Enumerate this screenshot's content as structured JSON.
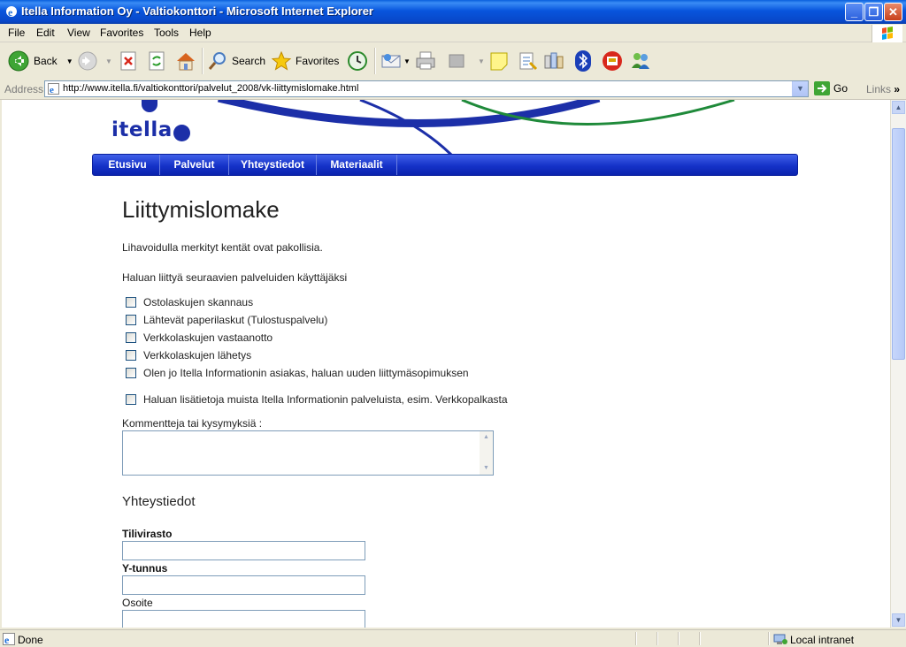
{
  "window": {
    "title": "Itella Information Oy - Valtiokonttori - Microsoft Internet Explorer",
    "buttons": [
      "_",
      "❐",
      "✕"
    ]
  },
  "menu": [
    "File",
    "Edit",
    "View",
    "Favorites",
    "Tools",
    "Help"
  ],
  "toolbar": {
    "back_label": "Back",
    "search_label": "Search",
    "favorites_label": "Favorites"
  },
  "address": {
    "label": "Address",
    "url": "http://www.itella.fi/valtiokonttori/palvelut_2008/vk-liittymislomake.html",
    "go_label": "Go",
    "links_label": "Links"
  },
  "page": {
    "logo_text": "itella",
    "nav": [
      "Etusivu",
      "Palvelut",
      "Yhteystiedot",
      "Materiaalit"
    ],
    "heading": "Liittymislomake",
    "required_note": "Lihavoidulla merkityt kentät ovat pakollisia.",
    "services_intro": "Haluan liittyä seuraavien palveluiden käyttäjäksi",
    "services": [
      "Ostolaskujen skannaus",
      "Lähtevät paperilaskut (Tulostuspalvelu)",
      "Verkkolaskujen vastaanotto",
      "Verkkolaskujen lähetys",
      "Olen jo Itella Informationin asiakas, haluan uuden liittymäsopimuksen"
    ],
    "more_info": "Haluan lisätietoja muista Itella Informationin palveluista, esim. Verkkopalkasta",
    "comments_label": "Kommentteja tai kysymyksiä :",
    "contact_heading": "Yhteystiedot",
    "fields": [
      {
        "label": "Tilivirasto",
        "required": true
      },
      {
        "label": "Y-tunnus",
        "required": true
      },
      {
        "label": "Osoite",
        "required": false
      }
    ]
  },
  "status": {
    "text": "Done",
    "zone": "Local intranet"
  },
  "colors": {
    "brand_blue": "#1c2fa8",
    "nav_blue": "#1532c8",
    "swoosh_green": "#1f8a3a"
  }
}
